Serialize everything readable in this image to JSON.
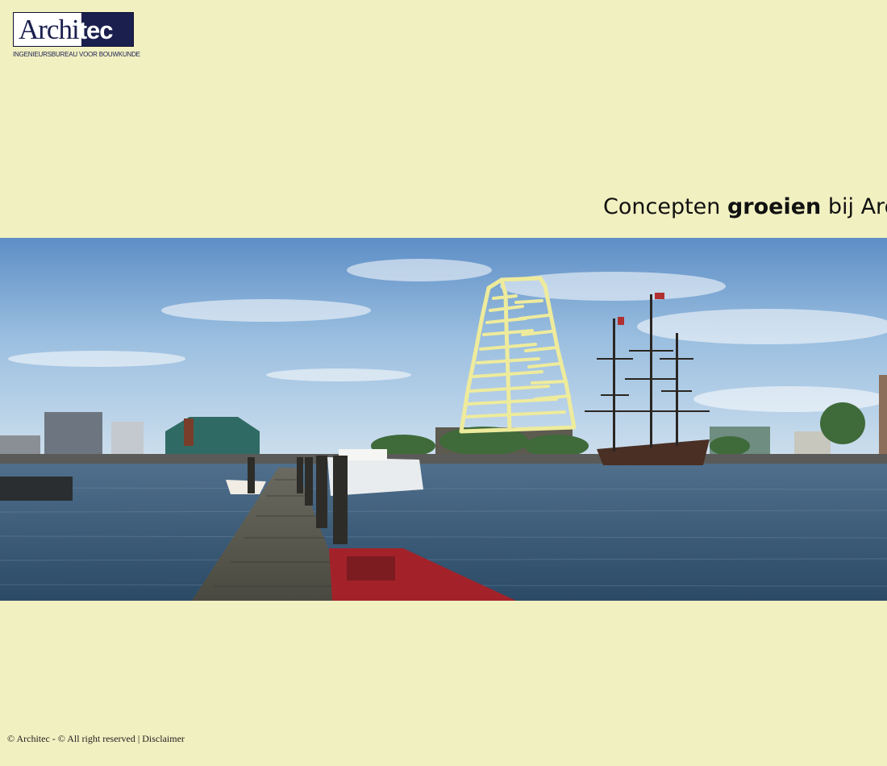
{
  "logo": {
    "word_part1": "Archi",
    "word_part2": "tec",
    "subtitle": "INGENIEURSBUREAU VOOR BOUWKUNDE"
  },
  "tagline": {
    "part1": "Concepten ",
    "part2_bold": "groeien",
    "part3": " bij Architec"
  },
  "banner": {
    "icon": "building-sketch-icon"
  },
  "footer": {
    "copyright": "© Architec - © All right reserved",
    "separator": " | ",
    "disclaimer": "Disclaimer"
  },
  "colors": {
    "background": "#f1f0c1",
    "brand_navy": "#1a1f4e",
    "sketch_yellow": "#eeeb9c"
  }
}
